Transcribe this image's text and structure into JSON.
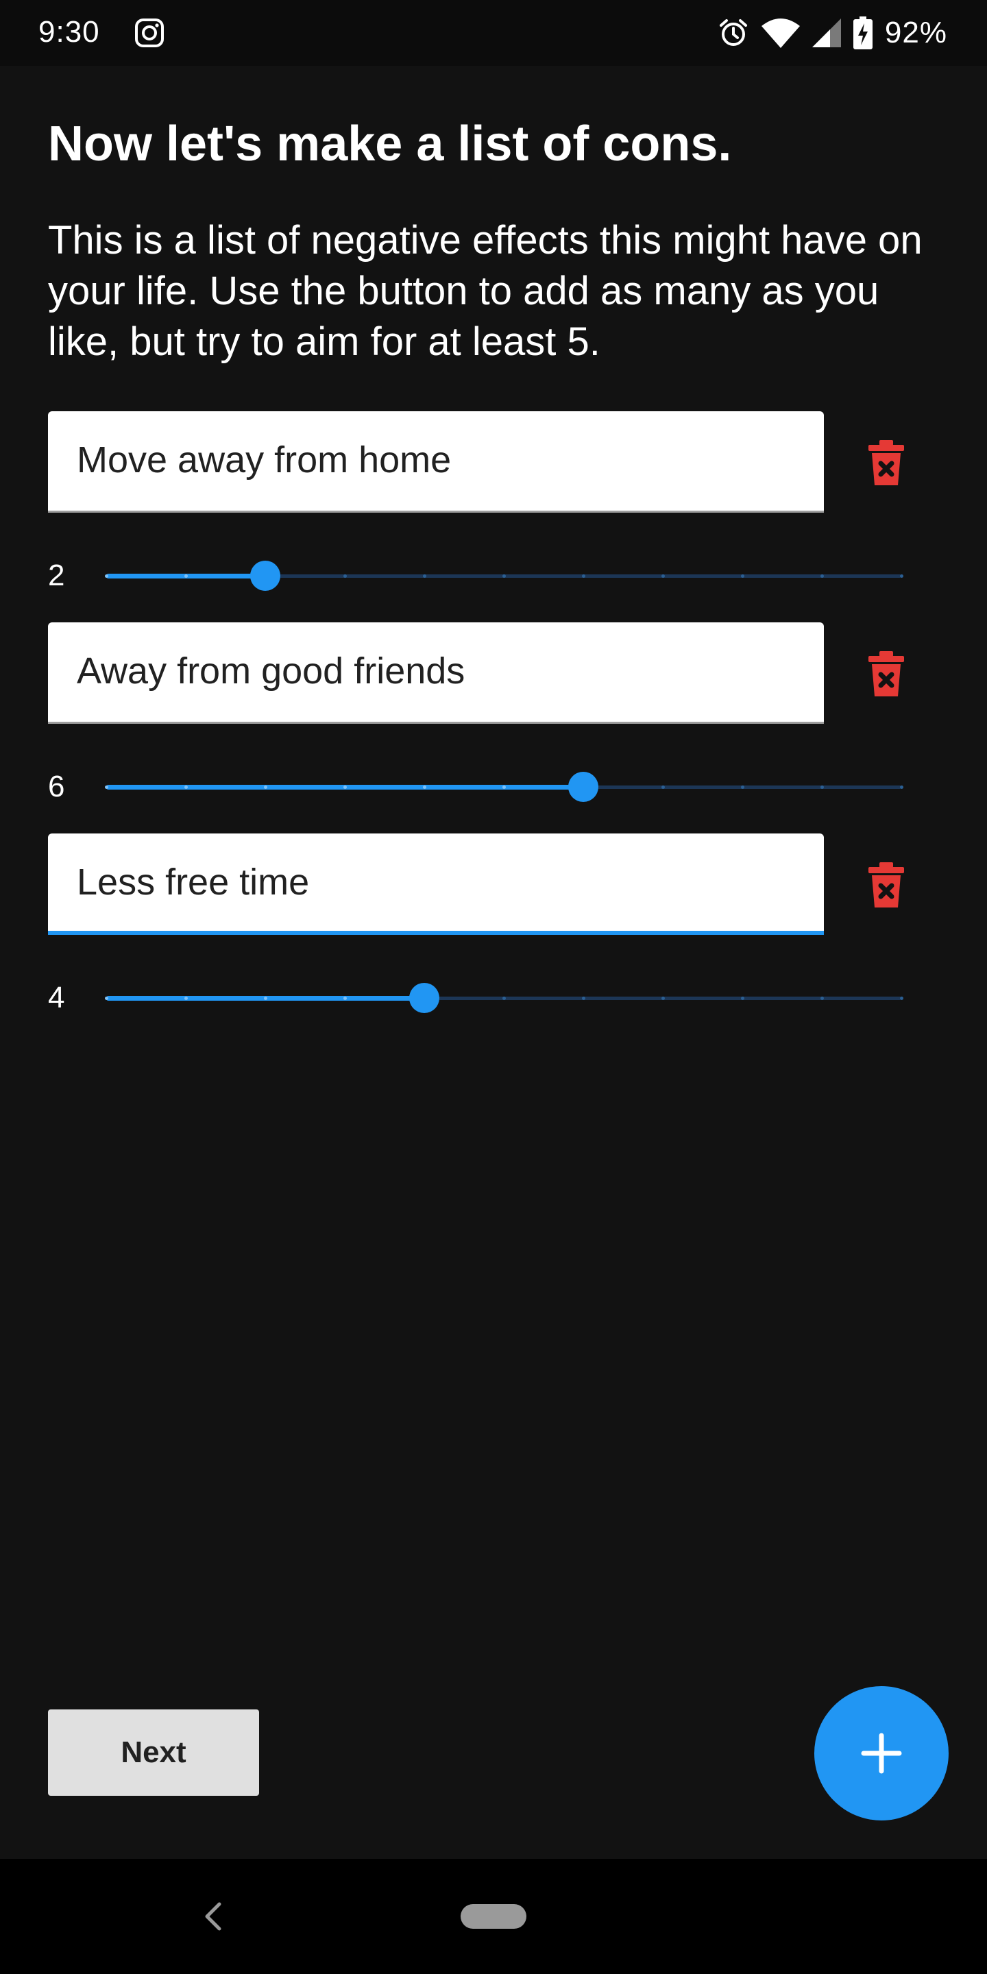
{
  "status_bar": {
    "time": "9:30",
    "battery": "92%",
    "icons": [
      "instagram-icon",
      "alarm-icon",
      "wifi-icon",
      "cell-signal-icon",
      "battery-charging-icon"
    ]
  },
  "page": {
    "title": "Now let's make a list of cons.",
    "description": "This is a list of negative effects this might have on your life. Use the button to add as many as you like, but try to aim for at least 5."
  },
  "slider": {
    "min": 0,
    "max": 10,
    "step": 1
  },
  "cons": [
    {
      "text": "Move away from home",
      "rating": "2",
      "focused": false
    },
    {
      "text": "Away from good friends",
      "rating": "6",
      "focused": false
    },
    {
      "text": "Less free time",
      "rating": "4",
      "focused": true
    }
  ],
  "actions": {
    "next_label": "Next",
    "add_icon": "plus-icon",
    "delete_icon": "trash-delete-icon"
  },
  "navigation": {
    "icons": [
      "back-icon",
      "home-pill-icon"
    ]
  },
  "colors": {
    "accent": "#2196f3",
    "background": "#121212",
    "delete": "#e53935",
    "track_inactive": "#1c3656"
  }
}
